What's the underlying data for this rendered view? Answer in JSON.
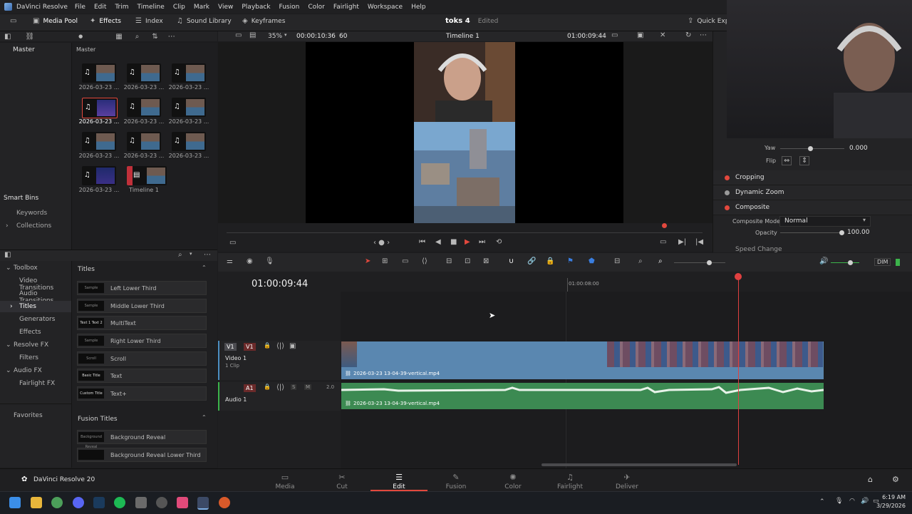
{
  "app": {
    "name": "DaVinci Resolve",
    "version_label": "DaVinci Resolve 20"
  },
  "menu": [
    "File",
    "Edit",
    "Trim",
    "Timeline",
    "Clip",
    "Mark",
    "View",
    "Playback",
    "Fusion",
    "Color",
    "Fairlight",
    "Workspace",
    "Help"
  ],
  "toolbar": {
    "media_pool": "Media Pool",
    "effects": "Effects",
    "index": "Index",
    "sound_library": "Sound Library",
    "keyframes": "Keyframes",
    "project_name": "toks 4",
    "project_status": "Edited",
    "quick_export": "Quick Exp"
  },
  "viewer": {
    "zoom": "35%",
    "source_timecode": "00:00:10:36",
    "fps": "60",
    "timeline_name": "Timeline 1",
    "record_timecode": "01:00:09:44"
  },
  "media_pool": {
    "root_bin": "Master",
    "breadcrumb": "Master",
    "clips": [
      {
        "name": "2026-03-23 ...",
        "selected": false,
        "timeline": false
      },
      {
        "name": "2026-03-23 ...",
        "selected": false,
        "timeline": false
      },
      {
        "name": "2026-03-23 ...",
        "selected": false,
        "timeline": false
      },
      {
        "name": "2026-03-23 ...",
        "selected": true,
        "timeline": false
      },
      {
        "name": "2026-03-23 ...",
        "selected": false,
        "timeline": false
      },
      {
        "name": "2026-03-23 ...",
        "selected": false,
        "timeline": false
      },
      {
        "name": "2026-03-23 ...",
        "selected": false,
        "timeline": false
      },
      {
        "name": "2026-03-23 ...",
        "selected": false,
        "timeline": false
      },
      {
        "name": "2026-03-23 ...",
        "selected": false,
        "timeline": false
      },
      {
        "name": "2026-03-23 ...",
        "selected": false,
        "timeline": false
      },
      {
        "name": "Timeline 1",
        "selected": false,
        "timeline": true
      }
    ],
    "smart_bins": "Smart Bins",
    "smart_bin_items": [
      "Keywords",
      "Collections"
    ]
  },
  "inspector": {
    "yaw_label": "Yaw",
    "yaw_value": "0.000",
    "flip_label": "Flip",
    "sections": {
      "cropping": "Cropping",
      "dynamic_zoom": "Dynamic Zoom",
      "composite": "Composite",
      "speed_change": "Speed Change"
    },
    "composite_mode_label": "Composite Mode",
    "composite_mode_value": "Normal",
    "opacity_label": "Opacity",
    "opacity_value": "100.00"
  },
  "effects": {
    "toolbox": "Toolbox",
    "tree": [
      "Video Transitions",
      "Audio Transitions",
      "Titles",
      "Generators",
      "Effects"
    ],
    "resolve_fx": "Resolve FX",
    "filters": "Filters",
    "audio_fx": "Audio FX",
    "fairlight_fx": "Fairlight FX",
    "favorites": "Favorites",
    "titles_header": "Titles",
    "titles": [
      {
        "label": "Left Lower Third",
        "thumb": "Sample"
      },
      {
        "label": "Middle Lower Third",
        "thumb": "Sample"
      },
      {
        "label": "MultiText",
        "thumb": "Text 1 Text 2"
      },
      {
        "label": "Right Lower Third",
        "thumb": "Sample"
      },
      {
        "label": "Scroll",
        "thumb": "Scroll"
      },
      {
        "label": "Text",
        "thumb": "Basic Title"
      },
      {
        "label": "Text+",
        "thumb": "Custom Title"
      }
    ],
    "fusion_titles_header": "Fusion Titles",
    "fusion_titles": [
      {
        "label": "Background Reveal",
        "thumb": "Background Reveal"
      },
      {
        "label": "Background Reveal Lower Third",
        "thumb": ""
      }
    ]
  },
  "timeline": {
    "timecode": "01:00:09:44",
    "ruler_mark": "01:00:08:00",
    "video_track": {
      "patch": "V1",
      "id": "V1",
      "name": "Video 1",
      "info": "1 Clip"
    },
    "audio_track": {
      "id": "A1",
      "name": "Audio 1",
      "channels": "2.0",
      "solo": "S",
      "mute": "M"
    },
    "clip_name": "2026-03-23 13-04-39-vertical.mp4",
    "audio_clip_name": "2026-03-23 13-04-39-vertical.mp4",
    "dim": "DIM"
  },
  "pages": [
    "Media",
    "Cut",
    "Edit",
    "Fusion",
    "Color",
    "Fairlight",
    "Deliver"
  ],
  "active_page": "Edit",
  "taskbar": {
    "time": "6:19 AM",
    "date": "3/29/2026"
  },
  "colors": {
    "accent": "#e2483d",
    "video_clip": "#5a87b0",
    "audio_clip": "#3c8a52",
    "playhead": "#e04040"
  }
}
